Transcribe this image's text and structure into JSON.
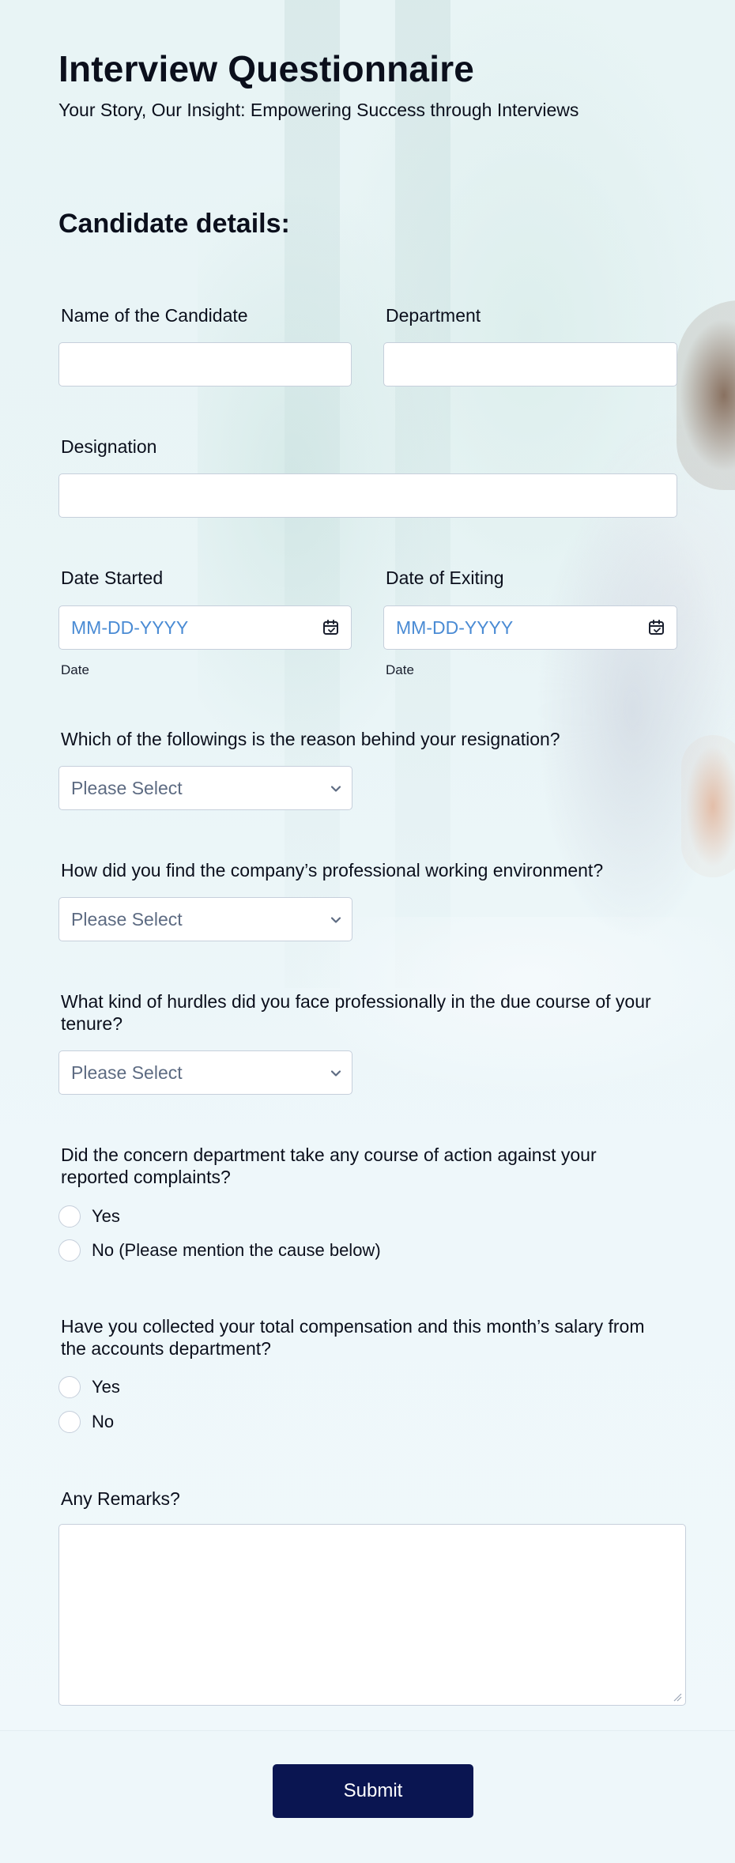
{
  "form": {
    "title": "Interview Questionnaire",
    "subtitle": "Your Story, Our Insight: Empowering Success through Interviews",
    "section_title": "Candidate details:"
  },
  "fields": {
    "candidate_name": {
      "label": "Name of the Candidate",
      "value": ""
    },
    "department": {
      "label": "Department",
      "value": ""
    },
    "designation": {
      "label": "Designation",
      "value": ""
    },
    "date_started": {
      "label": "Date Started",
      "placeholder": "MM-DD-YYYY",
      "sublabel": "Date"
    },
    "date_exiting": {
      "label": "Date of Exiting",
      "placeholder": "MM-DD-YYYY",
      "sublabel": "Date"
    }
  },
  "questions": {
    "resignation_reason": {
      "label": "Which of the followings is the reason behind your resignation?",
      "selected": "Please Select"
    },
    "work_environment": {
      "label": "How did you find the company’s professional working environment?",
      "selected": "Please Select"
    },
    "hurdles": {
      "label": "What kind of hurdles did you face professionally in the due course of your tenure?",
      "selected": "Please Select"
    },
    "complaints_action": {
      "label": "Did the concern department take any course of action against your reported complaints?",
      "options": [
        "Yes",
        "No (Please mention the cause below)"
      ]
    },
    "compensation": {
      "label": "Have you collected your total compensation and this month’s salary from the accounts department?",
      "options": [
        "Yes",
        "No"
      ]
    },
    "remarks": {
      "label": "Any Remarks?",
      "value": ""
    }
  },
  "actions": {
    "submit_label": "Submit"
  },
  "colors": {
    "submit_bg": "#0a1551",
    "date_placeholder": "#4a8bd4",
    "select_placeholder": "#5d6b82",
    "border": "#c6cfdb"
  },
  "icons": {
    "date": "calendar-icon",
    "select": "chevron-down-icon"
  }
}
